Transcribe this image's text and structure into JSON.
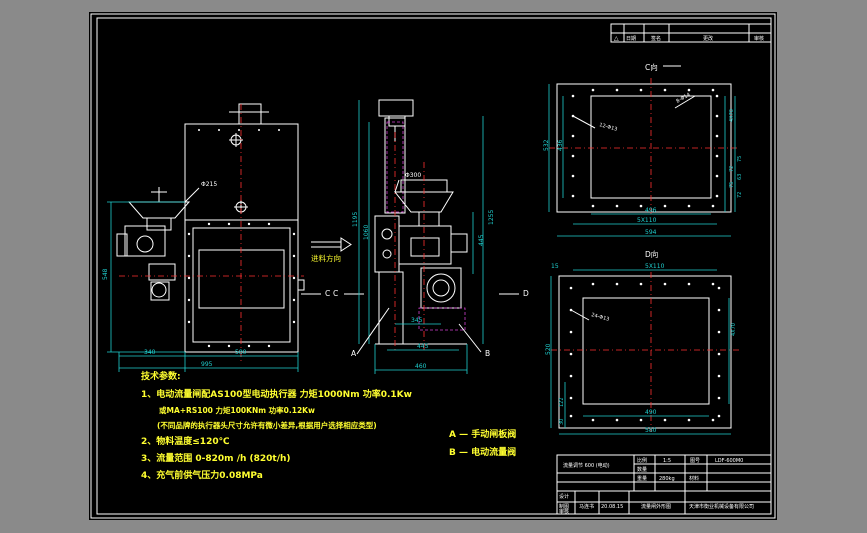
{
  "drawing_labels": {
    "view_c_title": "C向",
    "view_d_title": "D向",
    "flow_direction": "进料方向",
    "marker_c_left": "C",
    "marker_c_right": "C",
    "marker_d": "D",
    "marker_a": "A",
    "marker_b": "B"
  },
  "dimensions": {
    "front_w_340": "340",
    "front_w_580": "580",
    "front_w_995": "995",
    "front_h_548": "548",
    "front_dia_215": "Φ215",
    "side_h_1195": "1195",
    "side_h_1060": "1060",
    "side_h_1255": "1255",
    "side_h_445": "445",
    "side_dia_300": "Φ300",
    "side_w_445": "445",
    "side_w_345": "345",
    "side_w_460": "460",
    "c_top_holes": "8-Φ14",
    "c_bolt_holes": "12-Φ13",
    "c_h_532": "532",
    "c_h_436": "436",
    "c_h_4x70": "4X70",
    "c_h_75a": "75",
    "c_h_72a": "72",
    "c_h_63": "63",
    "c_h_75b": "75",
    "c_h_72b": "72",
    "c_w_496": "496",
    "c_w_5x110": "5X110",
    "c_w_594": "594",
    "d_w_5x110": "5X110",
    "d_left_15": "15",
    "d_bolt_holes": "24-Φ13",
    "d_h_4x70": "4X70",
    "d_h_520": "520",
    "d_h_122": "122",
    "d_h_30": "30",
    "d_w_490": "490",
    "d_w_580": "580"
  },
  "tech_notes": {
    "heading": "技术参数:",
    "line1": "1、电动流量闸配AS100型电动执行器   力矩1000Nm   功率0.1Kw",
    "line1b": "或MA+RS100 力矩100KNm   功率0.12Kw",
    "line1c": "(不同品牌的执行器头尺寸允许有微小差异,根据用户选择相应类型)",
    "line2": "2、物料温度≤120℃",
    "line3": "3、流量范围 0-820m /h    (820t/h)",
    "line4": "4、充气前供气压力0.08MPa",
    "legend_a": "A — 手动闸板阀",
    "legend_b": "B — 电动流量阀"
  },
  "revision_table": {
    "symbol": "△",
    "col_date": "日期",
    "col_sign": "签名",
    "col_content": "更改",
    "col_approve": "审核"
  },
  "title_block": {
    "product_name": "流量调节 600 (电动)",
    "scale_label": "比例",
    "scale_value": "1:5",
    "drawing_no_label": "图号",
    "drawing_no": "LDF-600M0",
    "qty_label": "数量",
    "weight_label": "重量",
    "weight_value": "280kg",
    "material_label": "材料",
    "row_designer": "设计",
    "row_drawn": "制图",
    "row_checked": "审核",
    "designer_name": "马连书",
    "date_value": "20.08.15",
    "drawing_title": "流量闸外形图",
    "company": "天津市衡业机械设备有限公司"
  }
}
